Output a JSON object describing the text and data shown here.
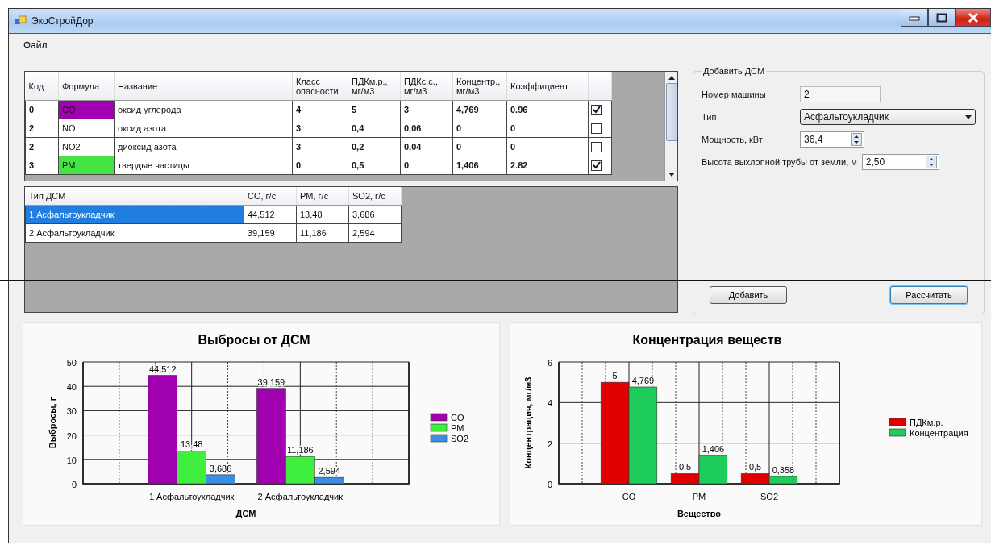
{
  "window": {
    "title": "ЭкоСтройДор"
  },
  "menu": [
    {
      "label": "Файл"
    }
  ],
  "pollutants_table": {
    "columns": [
      "Код",
      "Формула",
      "Название",
      "Класс опасности",
      "ПДКм.р., мг/м3",
      "ПДКс.с., мг/м3",
      "Концентр., мг/м3",
      "Коэффициент"
    ],
    "rows": [
      {
        "code": "0",
        "formula": "CO",
        "color": "#a000b0",
        "name": "оксид углерода",
        "hazard_class": "4",
        "pdk_mr": "5",
        "pdk_ss": "3",
        "concentration": "4,769",
        "coefficient": "0.96",
        "checked": true
      },
      {
        "code": "2",
        "formula": "NO",
        "name": "оксид азота",
        "hazard_class": "3",
        "pdk_mr": "0,4",
        "pdk_ss": "0,06",
        "concentration": "0",
        "coefficient": "0",
        "checked": false
      },
      {
        "code": "2",
        "formula": "NO2",
        "name": "диоксид азота",
        "hazard_class": "3",
        "pdk_mr": "0,2",
        "pdk_ss": "0,04",
        "concentration": "0",
        "coefficient": "0",
        "checked": false
      },
      {
        "code": "3",
        "formula": "PM",
        "color": "#44e444",
        "name": "твердые частицы",
        "hazard_class": "0",
        "pdk_mr": "0,5",
        "pdk_ss": "0",
        "concentration": "1,406",
        "coefficient": "2.82",
        "checked": true
      }
    ]
  },
  "machines_table": {
    "columns": [
      "Тип ДСМ",
      "CO, г/с",
      "PM, г/с",
      "SO2, г/с"
    ],
    "rows": [
      {
        "type": "1 Асфальтоукладчик",
        "co": "44,512",
        "pm": "13,48",
        "so2": "3,686",
        "selected": true
      },
      {
        "type": "2 Асфальтоукладчик",
        "co": "39,159",
        "pm": "11,186",
        "so2": "2,594",
        "selected": false
      }
    ]
  },
  "add_form": {
    "title": "Добавить ДСМ",
    "fields": [
      {
        "kind": "text",
        "label": "Номер машины",
        "value": "2"
      },
      {
        "kind": "dropdown",
        "label": "Тип",
        "value": "Асфальтоукладчик"
      },
      {
        "kind": "spinner",
        "label": "Мощность, кВт",
        "value": "36,4"
      },
      {
        "kind": "spinner",
        "label": "Высота выхлопной трубы от земли, м",
        "value": "2,50"
      }
    ],
    "buttons": [
      {
        "label": "Добавить",
        "default": false
      },
      {
        "label": "Рассчитать",
        "default": true
      }
    ]
  },
  "charts": [
    {
      "chart_data": {
        "type": "bar",
        "grid": true,
        "legend": "right",
        "title": "Выбросы от ДСМ",
        "xlabel": "ДСМ",
        "ylabel": "Выбросы, г",
        "categories": [
          "1 Асфальтоукладчик",
          "2 Асфальтоукладчик"
        ],
        "ylim": [
          0,
          50
        ],
        "yticks": [
          0,
          10,
          20,
          30,
          40,
          50
        ],
        "series": [
          {
            "name": "CO",
            "color": "#a000b0",
            "values": [
              44.512,
              39.159
            ],
            "value_labels": [
              "44,512",
              "39,159"
            ]
          },
          {
            "name": "PM",
            "color": "#40ee40",
            "values": [
              13.48,
              11.186
            ],
            "value_labels": [
              "13,48",
              "11,186"
            ]
          },
          {
            "name": "SO2",
            "color": "#3a8ee6",
            "values": [
              3.686,
              2.594
            ],
            "value_labels": [
              "3,686",
              "2,594"
            ]
          }
        ]
      }
    },
    {
      "chart_data": {
        "type": "bar",
        "grid": true,
        "legend": "right",
        "title": "Концентрация веществ",
        "xlabel": "Вещество",
        "ylabel": "Концентрация, мг/м3",
        "categories": [
          "CO",
          "PM",
          "SO2"
        ],
        "ylim": [
          0,
          6
        ],
        "yticks": [
          0,
          2,
          4,
          6
        ],
        "series": [
          {
            "name": "ПДКм.р.",
            "color": "#e00000",
            "values": [
              5,
              0.5,
              0.5
            ],
            "value_labels": [
              "5",
              "0,5",
              "0,5"
            ]
          },
          {
            "name": "Концентрация",
            "color": "#1ecc5a",
            "values": [
              4.769,
              1.406,
              0.358
            ],
            "value_labels": [
              "4,769",
              "1,406",
              "0,358"
            ]
          }
        ]
      }
    }
  ]
}
